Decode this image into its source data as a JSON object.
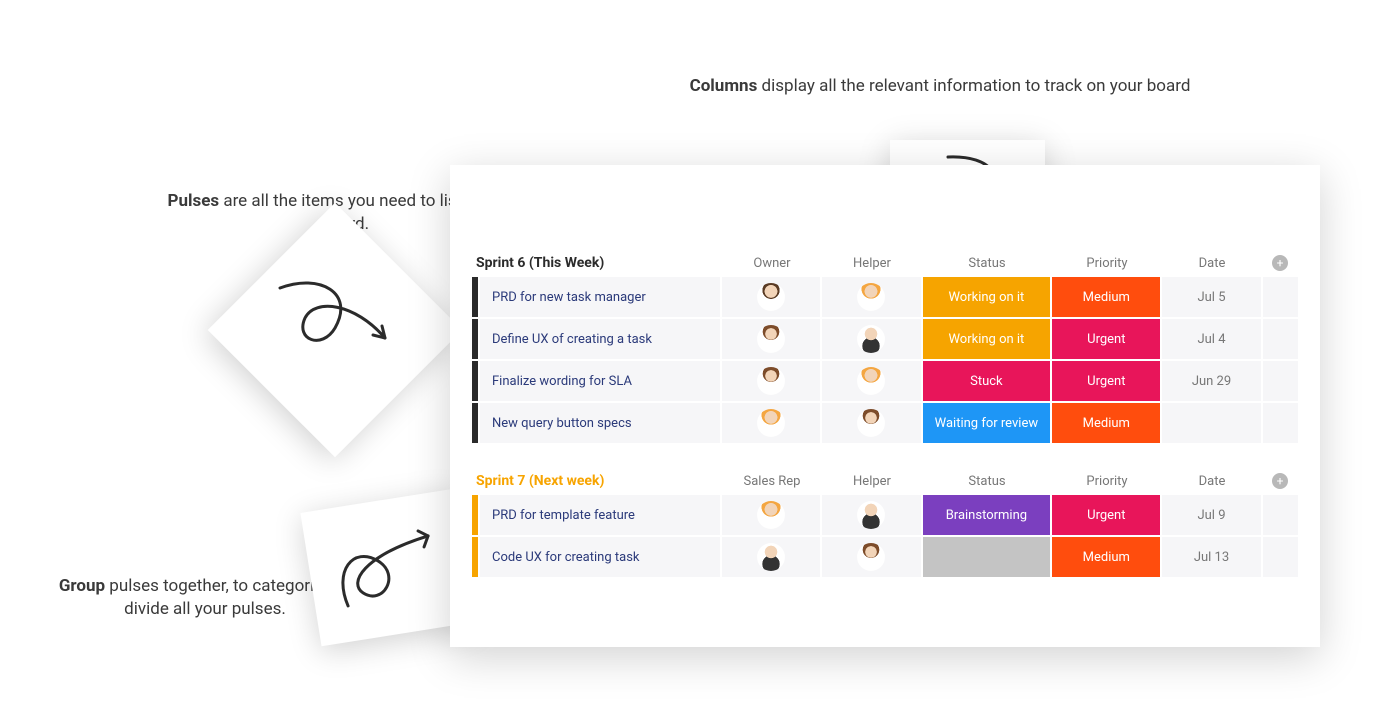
{
  "callouts": {
    "columns_bold": "Columns",
    "columns_rest": " display all the relevant information to track on your board",
    "pulses_bold": "Pulses",
    "pulses_rest": " are all the items you need to list on your board.",
    "group_bold": "Group",
    "group_rest": " pulses together, to categorize or divide all your pulses."
  },
  "status_colors": {
    "Working on it": "#f6a400",
    "Stuck": "#e8155a",
    "Waiting for review": "#1e96f6",
    "Brainstorming": "#7b3fbf",
    "": "#c4c4c4"
  },
  "priority_colors": {
    "Medium": "#ff4d0d",
    "Urgent": "#e8155a",
    "": "#c4c4c4"
  },
  "groups": [
    {
      "title": "Sprint 6 (This Week)",
      "accent": "#2b2b2b",
      "title_color": "#2b2b2b",
      "columns": [
        "Owner",
        "Helper",
        "Status",
        "Priority",
        "Date"
      ],
      "rows": [
        {
          "name": "PRD for new task manager",
          "owner": "av1",
          "helper": "av2",
          "status": "Working on it",
          "priority": "Medium",
          "date": "Jul 5"
        },
        {
          "name": "Define UX of creating a task",
          "owner": "av4",
          "helper": "av3",
          "status": "Working on it",
          "priority": "Urgent",
          "date": "Jul 4"
        },
        {
          "name": "Finalize wording for SLA",
          "owner": "av4",
          "helper": "av2",
          "status": "Stuck",
          "priority": "Urgent",
          "date": "Jun 29"
        },
        {
          "name": "New query button specs",
          "owner": "av2",
          "helper": "av4",
          "status": "Waiting for review",
          "priority": "Medium",
          "date": ""
        }
      ]
    },
    {
      "title": "Sprint 7 (Next week)",
      "accent": "#f7a400",
      "title_color": "#f7a400",
      "columns": [
        "Sales Rep",
        "Helper",
        "Status",
        "Priority",
        "Date"
      ],
      "rows": [
        {
          "name": "PRD for template feature",
          "owner": "av2",
          "helper": "av3",
          "status": "Brainstorming",
          "priority": "Urgent",
          "date": "Jul 9"
        },
        {
          "name": "Code UX for creating task",
          "owner": "av3",
          "helper": "av4",
          "status": "",
          "priority": "Medium",
          "date": "Jul 13"
        }
      ]
    }
  ]
}
